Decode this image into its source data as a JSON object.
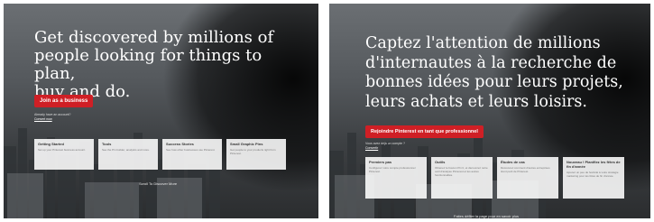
{
  "left": {
    "headline_lines": [
      "Get discovered by millions of",
      "people looking for things to plan,",
      "buy and do."
    ],
    "cta_label": "Join as a business",
    "account_prompt": "Already have an account?",
    "account_link": "Convert now",
    "cards": [
      {
        "title": "Getting Started",
        "desc": "Set up your Pinterest business account."
      },
      {
        "title": "Tools",
        "desc": "See the Pin builder, analytics and more."
      },
      {
        "title": "Success Stories",
        "desc": "See how other businesses use Pinterest."
      },
      {
        "title": "Small Graphic Pins",
        "desc": "Get people to your products right from Pinterest."
      }
    ],
    "more_label": "Scroll To Discover More"
  },
  "right": {
    "headline_lines": [
      "Captez l'attention de millions",
      "d'internautes à la recherche de",
      "bonnes idées pour leurs projets,",
      "leurs achats et leurs loisirs."
    ],
    "cta_label": "Rejoindre Pinterest en tant que professionnel",
    "account_prompt": "Vous avez déjà un compte ?",
    "account_link": "Convertir",
    "cards": [
      {
        "title": "Premiers pas",
        "desc": "Configurez votre compte professionnel Pinterest."
      },
      {
        "title": "Outils",
        "desc": "Obtenez le bouton Pin It, et découvrez notre outil d'analyse Pinterest et les autres fonctionnalités."
      },
      {
        "title": "Études de cas",
        "desc": "Découvrez comment d'autres entreprises tirent parti de Pinterest."
      },
      {
        "title": "Nouveau ! Planifiez les fêtes de fin d'année",
        "desc": "Ajoutez un peu de festivité à votre stratégie marketing pour les fêtes de fin d'année."
      }
    ],
    "more_label": "Faites défiler la page pour en savoir plus"
  },
  "colors": {
    "cta": "#cf1f25",
    "card_bg": "#ffffff",
    "headline": "#ffffff"
  }
}
